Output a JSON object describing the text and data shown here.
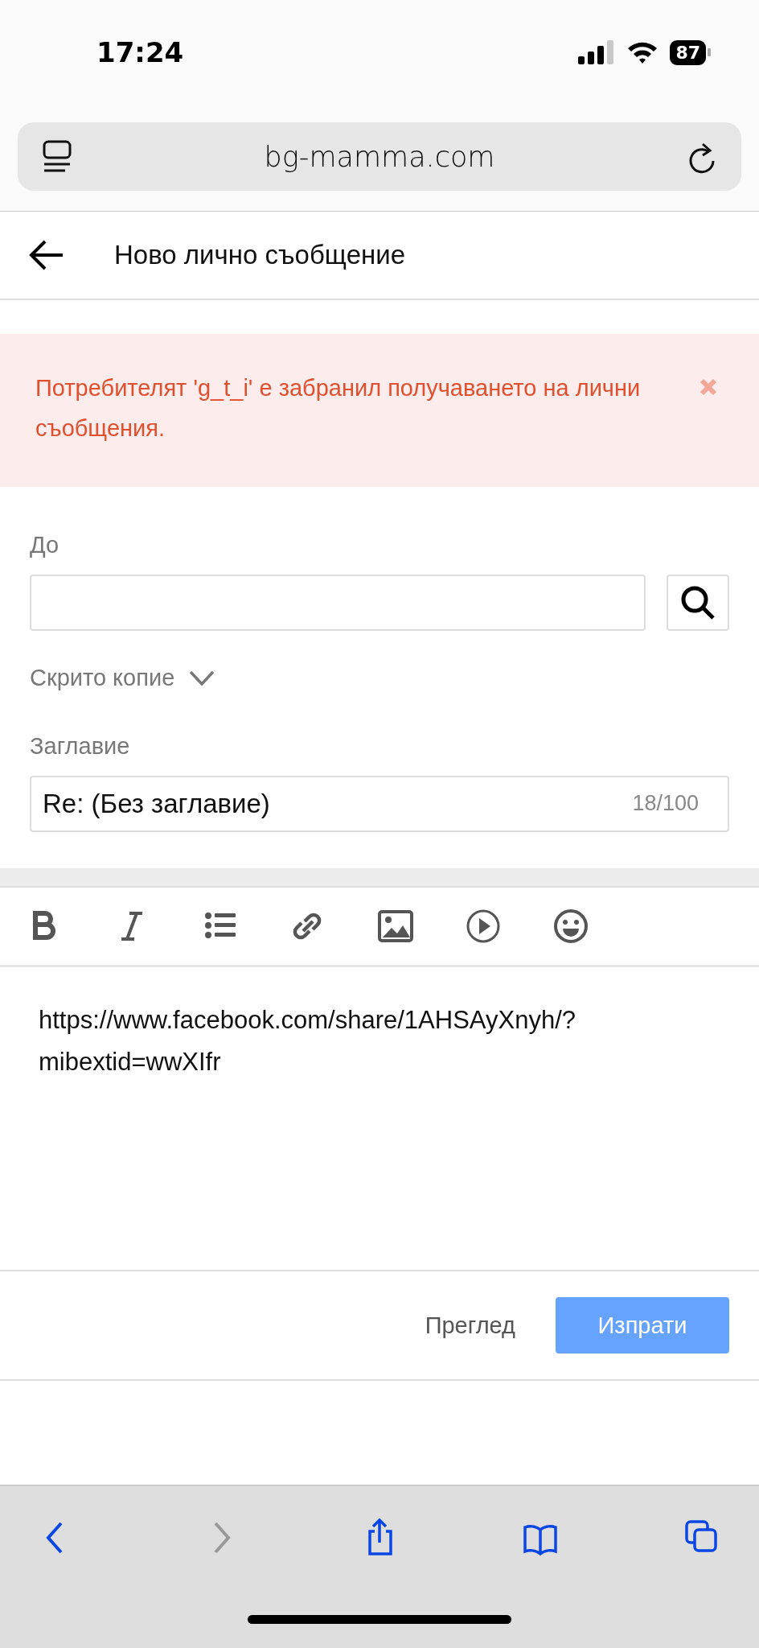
{
  "status_bar": {
    "time": "17:24",
    "battery": "87"
  },
  "browser": {
    "address": "bg-mamma.com"
  },
  "header": {
    "title": "Ново лично съобщение"
  },
  "alert": {
    "message": "Потребителят 'g_t_i' е забранил получаването на лични съобщения."
  },
  "form": {
    "to": {
      "label": "До"
    },
    "bcc": {
      "label": "Скрито копие",
      "expanded": false
    },
    "subject": {
      "label": "Заглавие",
      "value": "Re: (Без заглавие)",
      "counter": "18/100"
    }
  },
  "editor": {
    "tools": [
      {
        "kind": "bold"
      },
      {
        "kind": "italic"
      },
      {
        "kind": "list"
      },
      {
        "kind": "link"
      },
      {
        "kind": "image"
      },
      {
        "kind": "video"
      },
      {
        "kind": "emoji"
      }
    ],
    "body": "https://www.facebook.com/share/1AHSAyXnyh/?mibextid=wwXIfr"
  },
  "actions": {
    "preview": "Преглед",
    "send": "Изпрати"
  },
  "toolbar": [
    {
      "kind": "back",
      "disabled": false
    },
    {
      "kind": "forward",
      "disabled": true
    },
    {
      "kind": "share",
      "disabled": false
    },
    {
      "kind": "bookmarks",
      "disabled": false
    },
    {
      "kind": "tabs",
      "disabled": false
    }
  ]
}
